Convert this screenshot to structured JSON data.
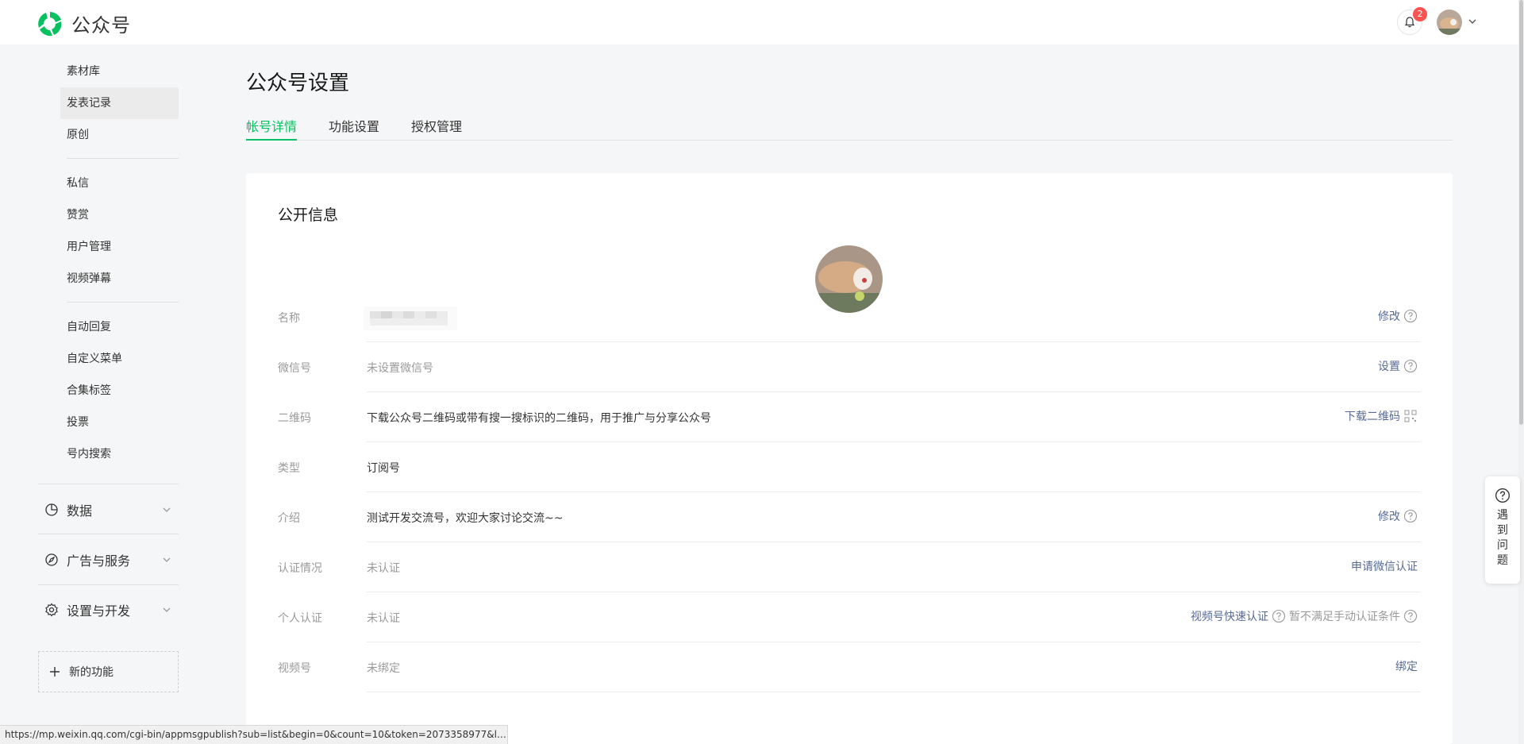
{
  "app": {
    "logo_text": "公众号",
    "notification_count": "2"
  },
  "sidebar": {
    "items_a": [
      {
        "label": "素材库"
      },
      {
        "label": "发表记录"
      },
      {
        "label": "原创"
      }
    ],
    "items_b": [
      {
        "label": "私信"
      },
      {
        "label": "赞赏"
      },
      {
        "label": "用户管理"
      },
      {
        "label": "视频弹幕"
      }
    ],
    "items_c": [
      {
        "label": "自动回复"
      },
      {
        "label": "自定义菜单"
      },
      {
        "label": "合集标签"
      },
      {
        "label": "投票"
      },
      {
        "label": "号内搜索"
      }
    ],
    "groups": [
      {
        "label": "数据",
        "icon": "pie-chart-icon"
      },
      {
        "label": "广告与服务",
        "icon": "compass-icon"
      },
      {
        "label": "设置与开发",
        "icon": "gear-icon"
      }
    ],
    "new_feature": "新的功能"
  },
  "page": {
    "title": "公众号设置",
    "tabs": [
      {
        "label": "帐号详情"
      },
      {
        "label": "功能设置"
      },
      {
        "label": "授权管理"
      }
    ]
  },
  "card": {
    "title": "公开信息",
    "rows": [
      {
        "label": "名称",
        "value": "",
        "action": "修改"
      },
      {
        "label": "微信号",
        "value": "未设置微信号",
        "action": "设置"
      },
      {
        "label": "二维码",
        "value": "下载公众号二维码或带有搜一搜标识的二维码，用于推广与分享公众号",
        "action": "下载二维码"
      },
      {
        "label": "类型",
        "value": "订阅号",
        "action": ""
      },
      {
        "label": "介绍",
        "value": "测试开发交流号，欢迎大家讨论交流~~",
        "action": "修改"
      },
      {
        "label": "认证情况",
        "value": "未认证",
        "action": "申请微信认证"
      },
      {
        "label": "个人认证",
        "value": "未认证",
        "action": "视频号快速认证",
        "action2": "暂不满足手动认证条件"
      },
      {
        "label": "视频号",
        "value": "未绑定",
        "action": "绑定"
      }
    ]
  },
  "help": {
    "label": "遇到问题"
  },
  "status_url": "https://mp.weixin.qq.com/cgi-bin/appmsgpublish?sub=list&begin=0&count=10&token=2073358977&lan..."
}
